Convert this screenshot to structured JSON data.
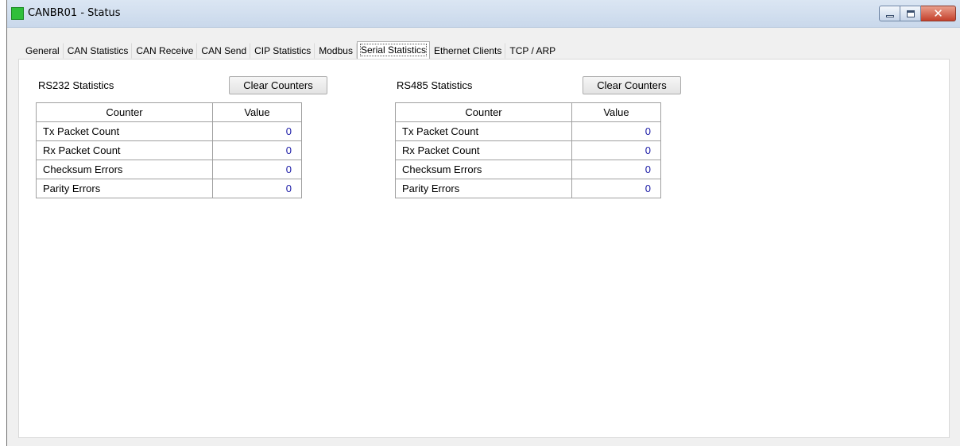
{
  "window": {
    "title": "CANBR01 - Status",
    "close_glyph": "✕",
    "icon_color": "#2fbf3a"
  },
  "tabs": [
    {
      "label": "General"
    },
    {
      "label": "CAN Statistics"
    },
    {
      "label": "CAN Receive"
    },
    {
      "label": "CAN Send"
    },
    {
      "label": "CIP Statistics"
    },
    {
      "label": "Modbus"
    },
    {
      "label": "Serial Statistics",
      "active": true
    },
    {
      "label": "Ethernet Clients"
    },
    {
      "label": "TCP / ARP"
    }
  ],
  "rs232": {
    "title": "RS232 Statistics",
    "clear_label": "Clear Counters",
    "headers": [
      "Counter",
      "Value"
    ],
    "rows": [
      {
        "counter": "Tx Packet Count",
        "value": "0"
      },
      {
        "counter": "Rx Packet Count",
        "value": "0"
      },
      {
        "counter": "Checksum Errors",
        "value": "0"
      },
      {
        "counter": "Parity Errors",
        "value": "0"
      }
    ]
  },
  "rs485": {
    "title": "RS485 Statistics",
    "clear_label": "Clear Counters",
    "headers": [
      "Counter",
      "Value"
    ],
    "rows": [
      {
        "counter": "Tx Packet Count",
        "value": "0"
      },
      {
        "counter": "Rx Packet Count",
        "value": "0"
      },
      {
        "counter": "Checksum Errors",
        "value": "0"
      },
      {
        "counter": "Parity Errors",
        "value": "0"
      }
    ]
  }
}
